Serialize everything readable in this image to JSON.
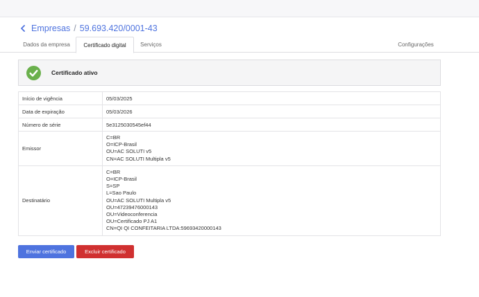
{
  "breadcrumb": {
    "parent": "Empresas",
    "separator": "/",
    "current": "59.693.420/0001-43"
  },
  "tabs": [
    {
      "label": "Dados da empresa",
      "active": false
    },
    {
      "label": "Certificado digital",
      "active": true
    },
    {
      "label": "Serviços",
      "active": false
    },
    {
      "label": "Configurações",
      "active": false
    }
  ],
  "status": {
    "text": "Certificado ativo",
    "icon": "check-circle-icon",
    "color": "#6ab04c"
  },
  "details": {
    "start_label": "Início de vigência",
    "start_value": "05/03/2025",
    "expiry_label": "Data de expiração",
    "expiry_value": "05/03/2026",
    "serial_label": "Número de série",
    "serial_value": "5e3125030545ef44",
    "issuer_label": "Emissor",
    "issuer_lines": [
      "C=BR",
      "O=ICP-Brasil",
      "OU=AC SOLUTI v5",
      "CN=AC SOLUTI Multipla v5"
    ],
    "recipient_label": "Destinatário",
    "recipient_lines": [
      "C=BR",
      "O=ICP-Brasil",
      "S=SP",
      "L=Sao Paulo",
      "OU=AC SOLUTI Multipla v5",
      "OU=47239476000143",
      "OU=Videoconferencia",
      "OU=Certificado PJ A1",
      "CN=QI QI CONFEITARIA LTDA:59693420000143"
    ]
  },
  "actions": {
    "send_label": "Enviar certificado",
    "delete_label": "Excluir certificado",
    "send_color": "#4e73df",
    "delete_color": "#d03030"
  }
}
